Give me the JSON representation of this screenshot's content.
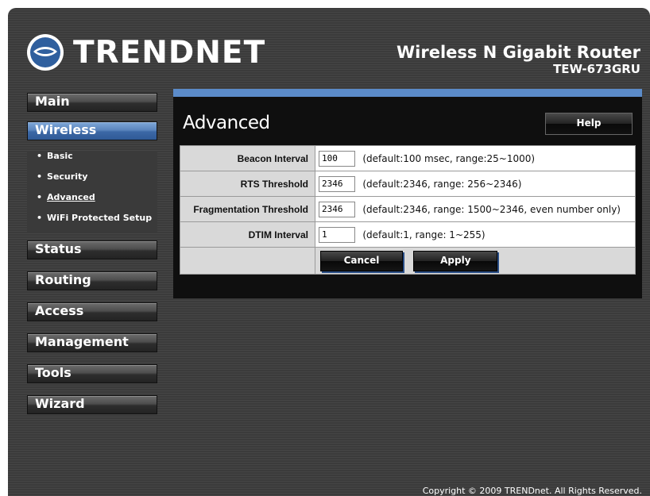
{
  "brand": {
    "logo_text": "TRENDNET",
    "product_name": "Wireless N Gigabit Router",
    "model": "TEW-673GRU"
  },
  "sidebar": {
    "main": "Main",
    "wireless": "Wireless",
    "sub_items": [
      {
        "label": "Basic"
      },
      {
        "label": "Security"
      },
      {
        "label": "Advanced"
      },
      {
        "label": "WiFi Protected Setup"
      }
    ],
    "status": "Status",
    "routing": "Routing",
    "access": "Access",
    "management": "Management",
    "tools": "Tools",
    "wizard": "Wizard"
  },
  "page": {
    "title": "Advanced",
    "help": "Help",
    "rows": [
      {
        "label": "Beacon Interval",
        "value": "100",
        "note": "(default:100 msec, range:25~1000)"
      },
      {
        "label": "RTS Threshold",
        "value": "2346",
        "note": "(default:2346, range: 256~2346)"
      },
      {
        "label": "Fragmentation Threshold",
        "value": "2346",
        "note": "(default:2346, range: 1500~2346, even number only)"
      },
      {
        "label": "DTIM Interval",
        "value": "1",
        "note": "(default:1, range: 1~255)"
      }
    ],
    "cancel": "Cancel",
    "apply": "Apply"
  },
  "footer": {
    "copyright": "Copyright © 2009 TRENDnet. All Rights Reserved."
  },
  "colors": {
    "accent": "#5b8bc9",
    "active_nav": "#4f7bb8",
    "panel_bg": "#0f0f0f",
    "page_bg": "#3b3b3b"
  },
  "icons": {
    "logo": "trendnet-logo-icon"
  }
}
